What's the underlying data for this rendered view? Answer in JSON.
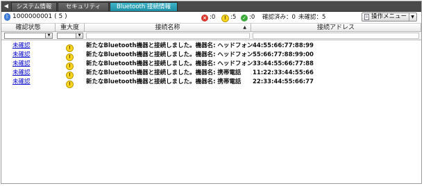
{
  "tabs": [
    {
      "label": "システム情報",
      "active": false
    },
    {
      "label": "セキュリティ",
      "active": false
    },
    {
      "label": "Bluetooth 接続情報",
      "active": true
    }
  ],
  "device": {
    "label": "1000000001 ( 5 )"
  },
  "stats": {
    "error": ":0",
    "warning": ":5",
    "ok": ":0",
    "confirmed": "確認済み：0",
    "unconfirmed": "未確認：5"
  },
  "menu_button": {
    "label": "操作メニュー"
  },
  "columns": {
    "status": "確認状態",
    "severity": "重大度",
    "name": "接続名称",
    "address": "接続アドレス"
  },
  "rows": [
    {
      "status": "未確認",
      "name": "新たなBluetooth機器と接続しました。機器名: ヘッドフォン",
      "address": "44:55:66:77:88:99"
    },
    {
      "status": "未確認",
      "name": "新たなBluetooth機器と接続しました。機器名: ヘッドフォン",
      "address": "55:66:77:88:99:00"
    },
    {
      "status": "未確認",
      "name": "新たなBluetooth機器と接続しました。機器名: ヘッドフォン",
      "address": "33:44:55:66:77:88"
    },
    {
      "status": "未確認",
      "name": "新たなBluetooth機器と接続しました。機器名: 携帯電話",
      "address": "11:22:33:44:55:66"
    },
    {
      "status": "未確認",
      "name": "新たなBluetooth機器と接続しました。機器名: 携帯電話",
      "address": "22:33:44:55:66:77"
    }
  ],
  "colors": {
    "active_tab": "#1e8fa6",
    "link": "#0000cc",
    "error": "#d9362b",
    "warning": "#ffd61f",
    "ok": "#3aa93a"
  }
}
